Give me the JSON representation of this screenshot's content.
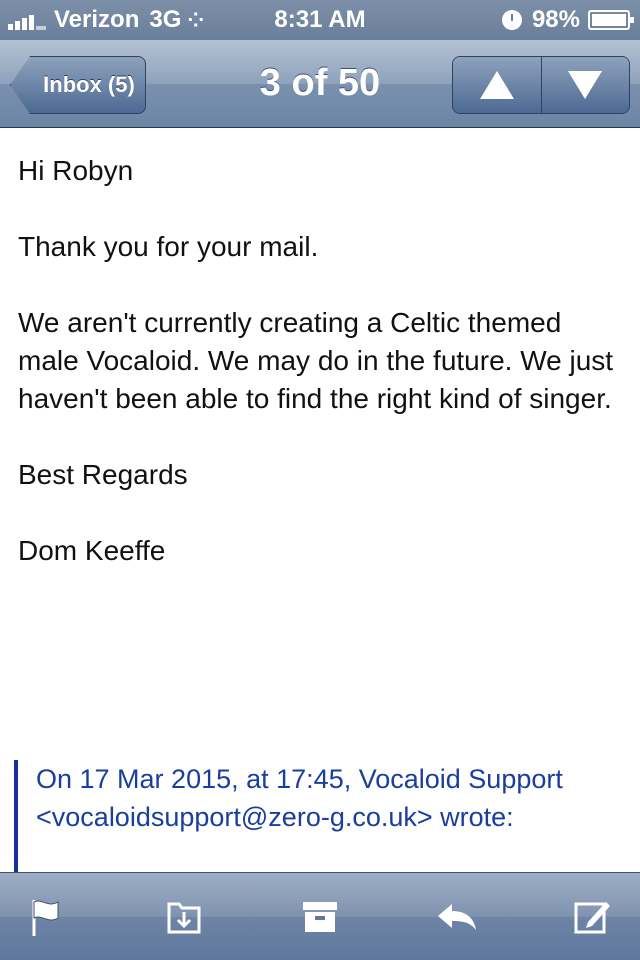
{
  "status_bar": {
    "carrier": "Verizon",
    "network": "3G",
    "time": "8:31 AM",
    "battery": "98%"
  },
  "nav": {
    "back_label": "Inbox (5)",
    "title": "3 of 50"
  },
  "message": {
    "paragraphs": [
      "Hi Robyn",
      "Thank you for your mail.",
      "We aren't currently creating a Celtic themed male Vocaloid. We may do in the future. We just haven't been able to find the right kind of singer.",
      "Best Regards",
      "Dom Keeffe"
    ],
    "quote": {
      "prefix": "On 17 Mar 2015, at 17:45, Vocaloid Support <",
      "email": "vocaloidsupport@zero-g.co.uk",
      "suffix": "> wrote:"
    }
  },
  "toolbar": {
    "icons": [
      "flag-icon",
      "move-folder-icon",
      "archive-icon",
      "reply-icon",
      "compose-icon"
    ]
  }
}
